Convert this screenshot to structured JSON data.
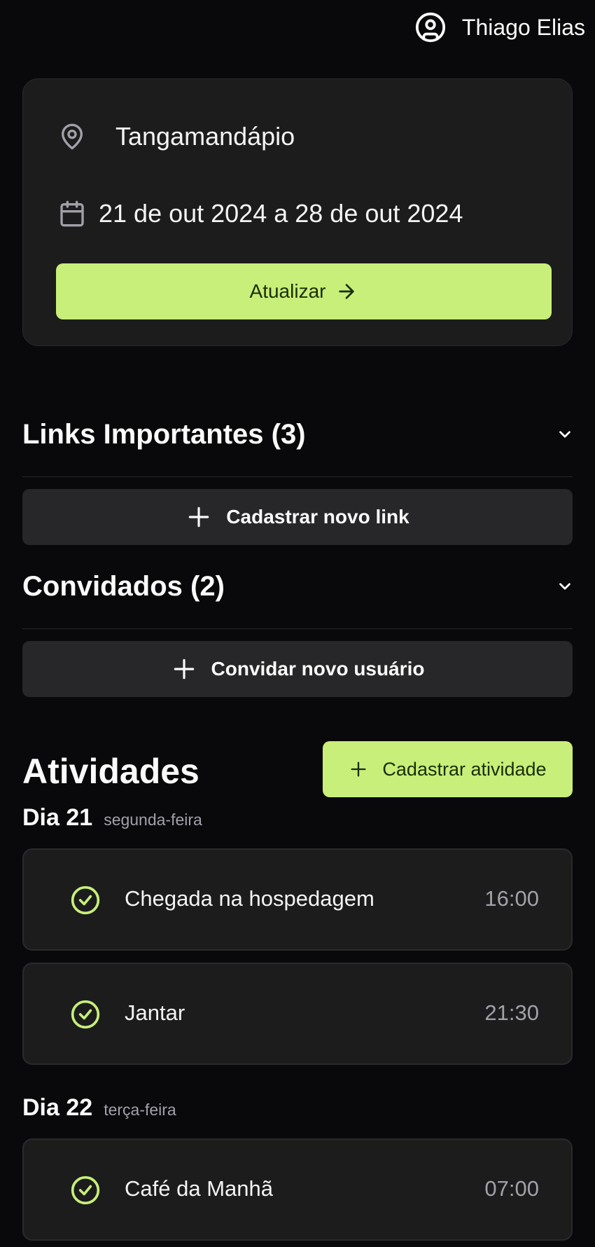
{
  "user": {
    "name": "Thiago Elias"
  },
  "trip": {
    "destination": "Tangamandápio",
    "date_range": "21 de out 2024 a 28 de out 2024",
    "update_label": "Atualizar"
  },
  "links": {
    "title": "Links Importantes (3)",
    "add_label": "Cadastrar novo link"
  },
  "guests": {
    "title": "Convidados (2)",
    "add_label": "Convidar novo usuário"
  },
  "activities": {
    "title": "Atividades",
    "add_label": "Cadastrar atividade",
    "days": [
      {
        "day": "Dia 21",
        "weekday": "segunda-feira",
        "items": [
          {
            "name": "Chegada na hospedagem",
            "time": "16:00"
          },
          {
            "name": "Jantar",
            "time": "21:30"
          }
        ]
      },
      {
        "day": "Dia 22",
        "weekday": "terça-feira",
        "items": [
          {
            "name": "Café da Manhã",
            "time": "07:00"
          }
        ]
      }
    ]
  },
  "colors": {
    "accent": "#c8ef7a",
    "background": "#09090b",
    "card": "#1c1c1c",
    "button_dark": "#27272a"
  }
}
